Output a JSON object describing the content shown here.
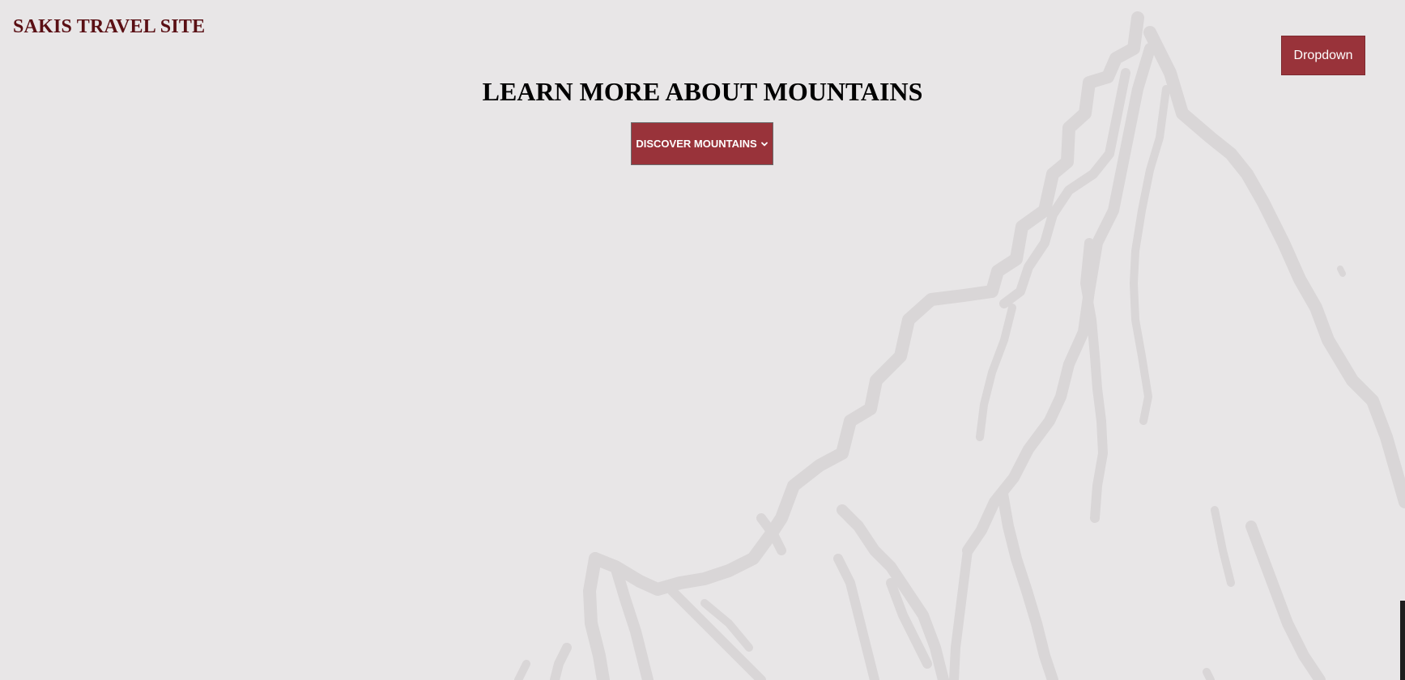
{
  "header": {
    "site_title": "SAKIS TRAVEL SITE",
    "dropdown_label": "Dropdown"
  },
  "main": {
    "title": "LEARN MORE ABOUT MOUNTAINS",
    "discover_label": "DISCOVER MOUNTAINS"
  },
  "icons": {
    "discover_chevron": "chevron-down-icon",
    "background": "mountain-illustration"
  },
  "colors": {
    "background": "#e8e6e7",
    "accent": "#99333a",
    "logo": "#5a0f14",
    "mountain_lines": "#d9d6d7"
  }
}
